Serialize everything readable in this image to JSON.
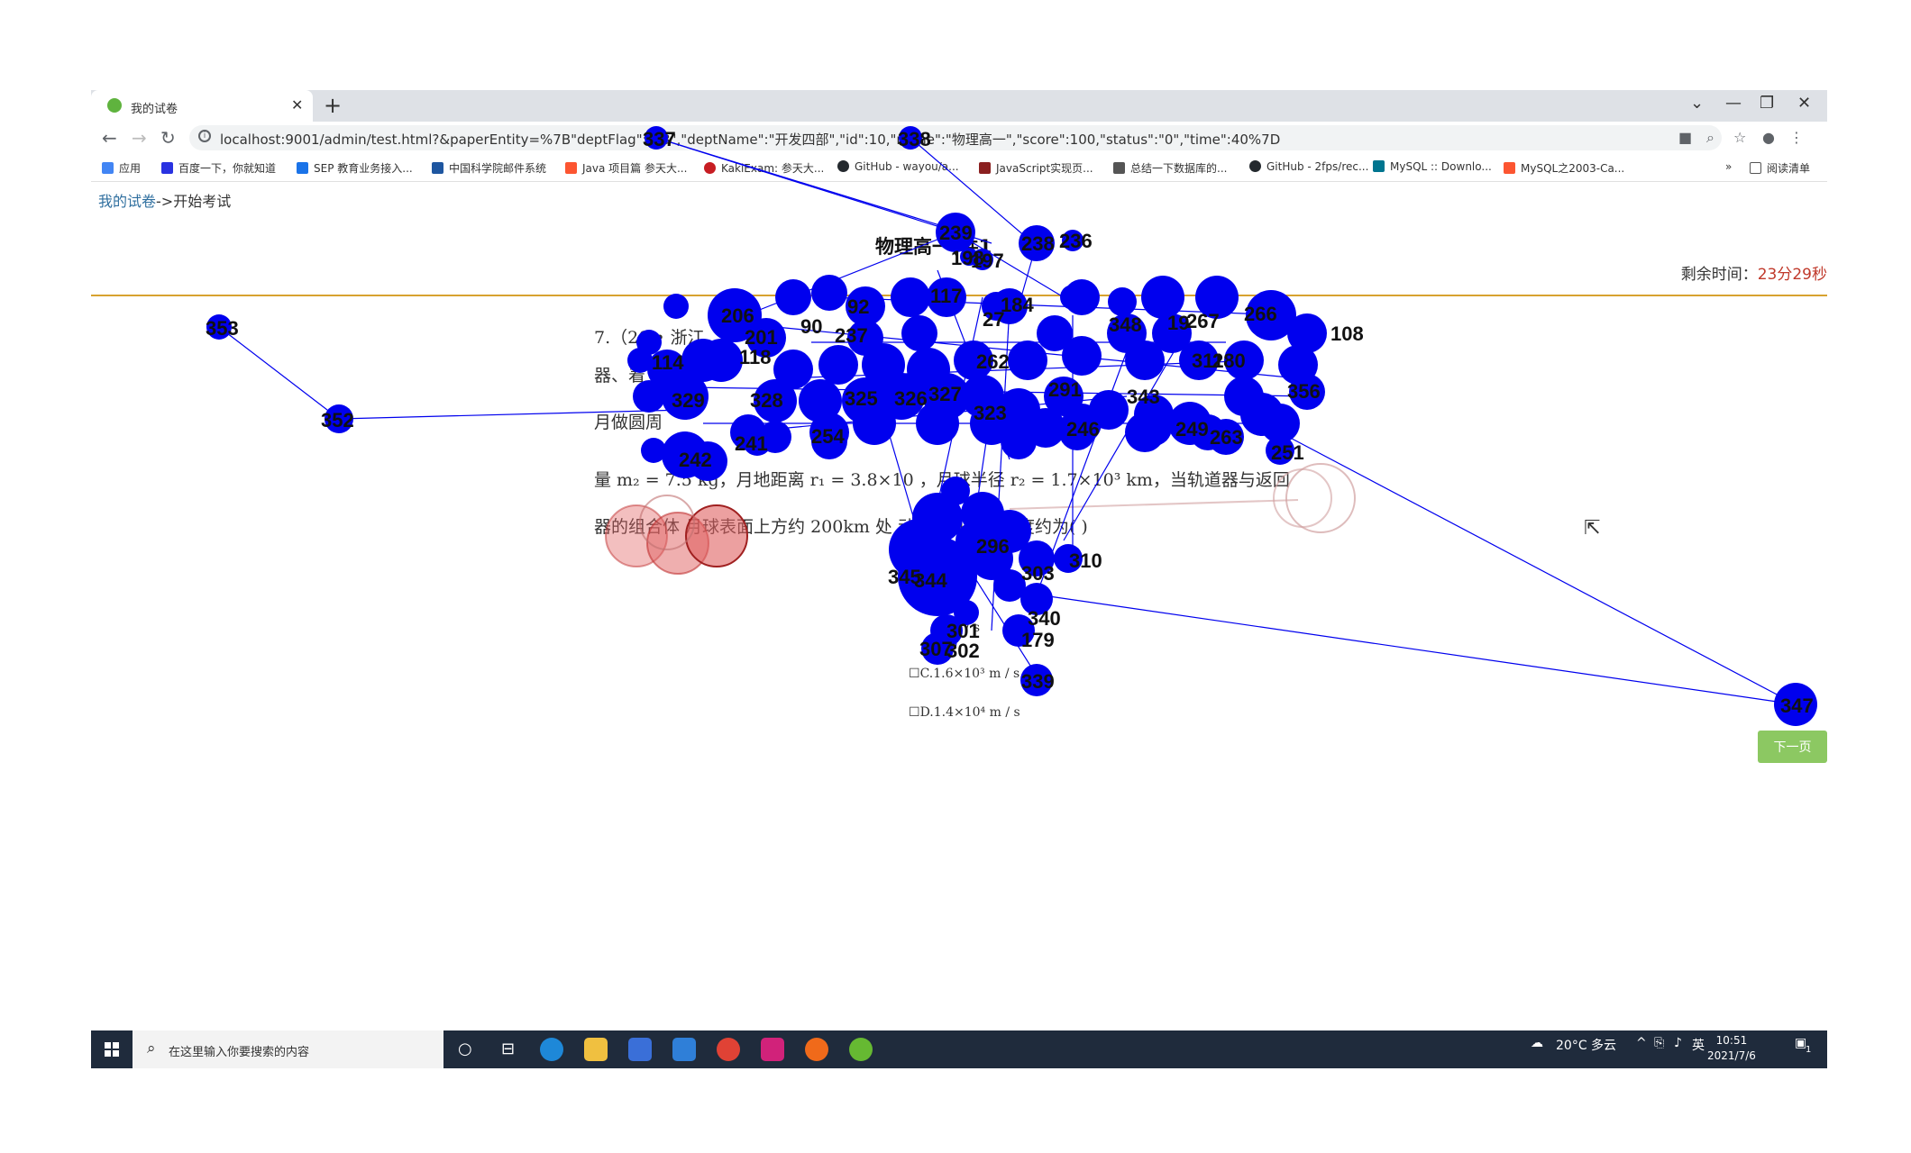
{
  "browser": {
    "tab_title": "我的试卷",
    "url": "localhost:9001/admin/test.html?&paperEntity=%7B\"deptFlag\":\"13\",\"deptName\":\"开发四部\",\"id\":10,\"name\":\"物理高一\",\"score\":100,\"status\":\"0\",\"time\":40%7D",
    "bookmarks": [
      {
        "label": "应用",
        "icon": "apps-grid-icon",
        "color": "#4285f4"
      },
      {
        "label": "百度一下，你就知道",
        "icon": "baidu-paw-icon",
        "color": "#2932e1"
      },
      {
        "label": "SEP 教育业务接入...",
        "icon": "sep-globe-icon",
        "color": "#1a73e8"
      },
      {
        "label": "中国科学院邮件系统",
        "icon": "mail-icon",
        "color": "#1e56a0"
      },
      {
        "label": "Java 项目篇 参天大...",
        "icon": "csdn-icon",
        "color": "#fc5531"
      },
      {
        "label": "KakiExam: 参天大...",
        "icon": "gitee-icon",
        "color": "#c71d23"
      },
      {
        "label": "GitHub - wayou/a...",
        "icon": "github-icon",
        "color": "#24292e"
      },
      {
        "label": "JavaScript实现页...",
        "icon": "bookmark-icon",
        "color": "#8b2020"
      },
      {
        "label": "总结一下数据库的...",
        "icon": "leaf-icon",
        "color": "#555555"
      },
      {
        "label": "GitHub - 2fps/rec...",
        "icon": "github-icon",
        "color": "#24292e"
      },
      {
        "label": "MySQL :: Downlo...",
        "icon": "mysql-icon",
        "color": "#00758f"
      },
      {
        "label": "MySQL之2003-Ca...",
        "icon": "csdn-icon",
        "color": "#fc5531"
      }
    ],
    "more_label": "»",
    "reading_list": "阅读清单"
  },
  "page": {
    "breadcrumb_link": "我的试卷",
    "breadcrumb_sep": "->",
    "breadcrumb_current": "开始考试",
    "paper_title": "物理高一(共1",
    "timer_label": "剩余时间：",
    "timer_value": "23分29秒",
    "question_lines": [
      "7.（20  • 浙江",
      "器、着",
      "月做圆周",
      "量 m₂ = 7.5     kg，月地距离 r₁ = 3.8×10  ，月球半径 r₂ = 1.7×10³ km，当轨道器与返回",
      "器的组合体  月球表面上方约 200km 处         动时，其环绕速度约为(        )"
    ],
    "options": [
      "C.1.6×10³ m / s",
      "D.1.4×10⁴ m / s"
    ],
    "option_a_fragment": "m / s",
    "next_button": "下一页"
  },
  "taskbar": {
    "search_placeholder": "在这里输入你要搜索的内容",
    "weather": "20°C  多云",
    "ime": "英",
    "time": "10:51",
    "date": "2021/7/6",
    "notification_count": "1"
  },
  "graph": {
    "node_color": "#0000ee",
    "link_color": "#0000ee",
    "nodes": [
      {
        "id": "337",
        "r": 12
      },
      {
        "id": "338",
        "r": 12
      },
      {
        "id": "239",
        "r": 18
      },
      {
        "id": "238",
        "r": 18
      },
      {
        "id": "236",
        "r": 12
      },
      {
        "id": "197",
        "r": 12
      },
      {
        "id": "198",
        "r": 10
      },
      {
        "id": "353",
        "r": 12
      },
      {
        "id": "352",
        "r": 14
      },
      {
        "id": "206",
        "r": 30
      },
      {
        "id": "201",
        "r": 20
      },
      {
        "id": "117",
        "r": 20
      },
      {
        "id": "92",
        "r": 18
      },
      {
        "id": "90",
        "r": 20
      },
      {
        "id": "237",
        "r": 20
      },
      {
        "id": "184",
        "r": 18
      },
      {
        "id": "348",
        "r": 22
      },
      {
        "id": "267",
        "r": 22
      },
      {
        "id": "266",
        "r": 24
      },
      {
        "id": "108",
        "r": 18
      },
      {
        "id": "329",
        "r": 24
      },
      {
        "id": "328",
        "r": 24
      },
      {
        "id": "325",
        "r": 24
      },
      {
        "id": "327",
        "r": 22
      },
      {
        "id": "323",
        "r": 22
      },
      {
        "id": "291",
        "r": 22
      },
      {
        "id": "280",
        "r": 22
      },
      {
        "id": "356",
        "r": 18
      },
      {
        "id": "254",
        "r": 22
      },
      {
        "id": "241",
        "r": 16
      },
      {
        "id": "242",
        "r": 26
      },
      {
        "id": "246",
        "r": 20
      },
      {
        "id": "249",
        "r": 22
      },
      {
        "id": "251",
        "r": 16
      },
      {
        "id": "263",
        "r": 16
      },
      {
        "id": "345",
        "r": 44
      },
      {
        "id": "344",
        "r": 30
      },
      {
        "id": "310",
        "r": 16
      },
      {
        "id": "303",
        "r": 18
      },
      {
        "id": "340",
        "r": 18
      },
      {
        "id": "179",
        "r": 18
      },
      {
        "id": "307",
        "r": 18
      },
      {
        "id": "339",
        "r": 18
      },
      {
        "id": "347",
        "r": 24
      },
      {
        "id": "114",
        "r": 22
      },
      {
        "id": "118",
        "r": 20
      },
      {
        "id": "114b",
        "r": 20
      },
      {
        "id": "326",
        "r": 22
      },
      {
        "id": "262",
        "r": 20
      },
      {
        "id": "27",
        "r": 22
      },
      {
        "id": "19",
        "r": 20
      },
      {
        "id": "296",
        "r": 24
      },
      {
        "id": "301",
        "r": 20
      },
      {
        "id": "302",
        "r": 20
      },
      {
        "id": "311",
        "r": 20
      },
      {
        "id": "343",
        "r": 22
      }
    ]
  }
}
